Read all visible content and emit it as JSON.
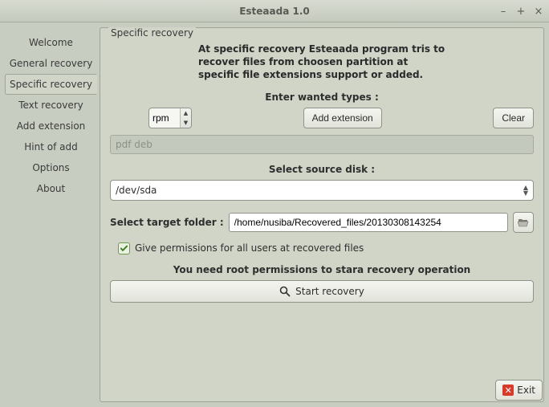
{
  "window": {
    "title": "Esteaada 1.0"
  },
  "tabs": [
    {
      "label": "Welcome"
    },
    {
      "label": "General recovery"
    },
    {
      "label": "Specific recovery"
    },
    {
      "label": "Text recovery"
    },
    {
      "label": "Add extension"
    },
    {
      "label": "Hint of add"
    },
    {
      "label": "Options"
    },
    {
      "label": "About"
    }
  ],
  "panel": {
    "legend": "Specific recovery",
    "intro_l1": "At specific recovery Esteaada program tris to",
    "intro_l2": "recover files from choosen partition at",
    "intro_l3": "specific file extensions support or added.",
    "types_label": "Enter wanted types :",
    "type_value": "rpm",
    "add_ext_label": "Add extension",
    "clear_label": "Clear",
    "pending_types": "pdf deb",
    "source_label": "Select source disk :",
    "source_value": "/dev/sda",
    "target_label": "Select target folder :",
    "target_value": "/home/nusiba/Recovered_files/20130308143254",
    "perm_label": "Give permissions for all users at recovered files",
    "root_label": "You need root permissions to stara recovery operation",
    "start_label": "Start recovery"
  },
  "footer": {
    "exit_label": "Exit"
  }
}
